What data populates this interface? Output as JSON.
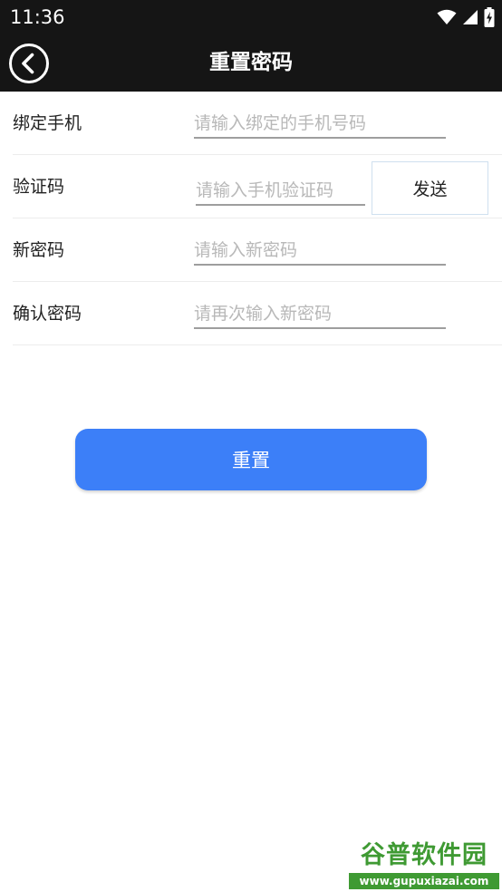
{
  "status_bar": {
    "time": "11:36",
    "icons": [
      "wifi-icon",
      "cell-signal-icon",
      "battery-charging-icon"
    ]
  },
  "header": {
    "title": "重置密码",
    "back_icon": "chevron-left-circle-icon"
  },
  "form": {
    "rows": [
      {
        "label": "绑定手机",
        "placeholder": "请输入绑定的手机号码",
        "value": ""
      },
      {
        "label": "验证码",
        "placeholder": "请输入手机验证码",
        "value": "",
        "button_label": "发送"
      },
      {
        "label": "新密码",
        "placeholder": "请输入新密码",
        "value": ""
      },
      {
        "label": "确认密码",
        "placeholder": "请再次输入新密码",
        "value": ""
      }
    ]
  },
  "reset_button": {
    "label": "重置"
  },
  "watermark": {
    "logo_text": "谷普软件园",
    "url": "www.gupuxiazai.com"
  },
  "colors": {
    "status_bar_bg": "#151515",
    "header_bg": "#151515",
    "accent": "#3c7ff8",
    "input_underline": "#9e9e9e",
    "placeholder": "#b8b8b8",
    "watermark_green": "#3f9a33"
  }
}
